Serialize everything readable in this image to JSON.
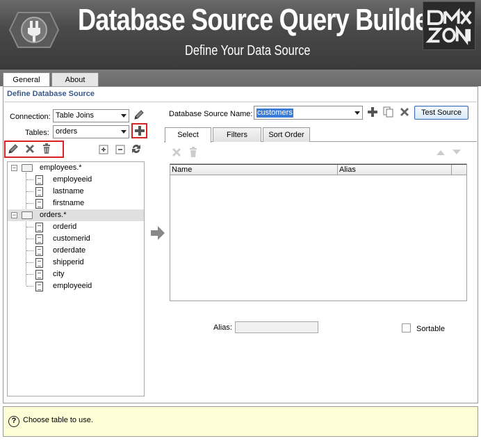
{
  "header": {
    "title": "Database Source Query Builder",
    "subtitle": "Define Your Data Source"
  },
  "top_tabs": [
    {
      "label": "General",
      "active": true
    },
    {
      "label": "About",
      "active": false
    }
  ],
  "section_title": "Define Database Source",
  "left": {
    "connection_label": "Connection:",
    "connection_value": "Table Joins",
    "tables_label": "Tables:",
    "tables_value": "orders"
  },
  "tree": [
    {
      "name": "employees.*",
      "selected": false,
      "fields": [
        "employeeid",
        "lastname",
        "firstname"
      ]
    },
    {
      "name": "orders.*",
      "selected": true,
      "fields": [
        "orderid",
        "customerid",
        "orderdate",
        "shipperid",
        "city",
        "employeeid"
      ]
    }
  ],
  "right": {
    "source_name_label": "Database Source Name:",
    "source_name_value": "customers",
    "test_button": "Test Source",
    "tabs": [
      {
        "label": "Select",
        "active": true
      },
      {
        "label": "Filters",
        "active": false
      },
      {
        "label": "Sort Order",
        "active": false
      }
    ],
    "grid_columns": [
      "Name",
      "Alias"
    ],
    "alias_label": "Alias:",
    "alias_value": "",
    "sortable_label": "Sortable"
  },
  "status": {
    "message": "Choose table to use."
  },
  "colors": {
    "accent_red": "#dd2222",
    "section_title": "#3a5a8c",
    "status_bg": "#fdfdd6",
    "selection_blue": "#3a7bd5"
  }
}
